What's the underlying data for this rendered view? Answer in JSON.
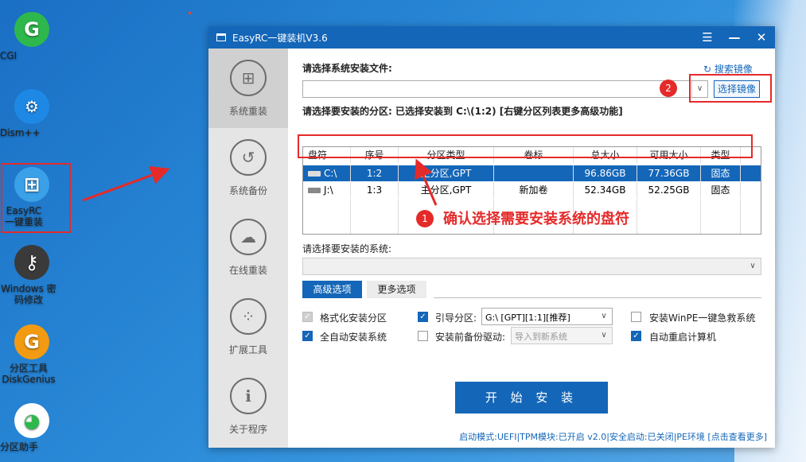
{
  "desktop": {
    "icons": [
      {
        "label": "CGI",
        "glyph": "G",
        "color": "#2eb84c"
      },
      {
        "label": "Dism++",
        "glyph": "⚙",
        "color": "#1e88e5"
      },
      {
        "label": "EasyRC 一键重装",
        "glyph": "⊞",
        "color": "#3aa0e8"
      },
      {
        "label": "Windows 密码修改",
        "glyph": "⚷",
        "color": "#3a3a3a"
      },
      {
        "label": "分区工具 DiskGenius",
        "glyph": "G",
        "color": "#f29b12"
      },
      {
        "label": "分区助手",
        "glyph": "◕",
        "color": "#ffffff"
      }
    ]
  },
  "window": {
    "title": "EasyRC一键装机V3.6",
    "menu_icon": "menu-icon",
    "minimize": "—",
    "close": "✕"
  },
  "sidebar": {
    "items": [
      {
        "label": "系统重装",
        "icon": "windows-icon",
        "glyph": "⊞"
      },
      {
        "label": "系统备份",
        "icon": "backup-icon",
        "glyph": "↺"
      },
      {
        "label": "在线重装",
        "icon": "cloud-icon",
        "glyph": "☁"
      },
      {
        "label": "扩展工具",
        "icon": "tools-icon",
        "glyph": "⁘"
      },
      {
        "label": "关于程序",
        "icon": "info-icon",
        "glyph": "i"
      }
    ]
  },
  "main": {
    "install_file_label": "请选择系统安装文件:",
    "search_image": "搜索镜像",
    "select_image": "选择镜像",
    "partition_label": "请选择要安装的分区: 已选择安装到 C:\\(1:2) [右键分区列表更多高级功能]",
    "table": {
      "headers": [
        "盘符",
        "序号",
        "分区类型",
        "卷标",
        "总大小",
        "可用大小",
        "类型"
      ],
      "rows": [
        [
          "C:\\",
          "1:2",
          "主分区,GPT",
          "",
          "96.86GB",
          "77.36GB",
          "固态"
        ],
        [
          "J:\\",
          "1:3",
          "主分区,GPT",
          "新加卷",
          "52.34GB",
          "52.25GB",
          "固态"
        ]
      ]
    },
    "system_label": "请选择要安装的系统:",
    "tabs": [
      "高级选项",
      "更多选项"
    ],
    "options": {
      "format": "格式化安装分区",
      "auto_install": "全自动安装系统",
      "boot_partition": "引导分区:",
      "boot_value": "G:\\ [GPT][1:1][推荐]",
      "backup_driver": "安装前备份驱动:",
      "backup_value": "导入到新系统",
      "winpe": "安装WinPE一键急救系统",
      "auto_restart": "自动重启计算机"
    },
    "start_button": "开 始 安 装",
    "status": "启动模式:UEFI|TPM模块:已开启 v2.0|安全启动:已关闭|PE环境 [点击查看更多]"
  },
  "annotations": {
    "num1": "1",
    "num2": "2",
    "text1": "确认选择需要安装系统的盘符",
    "accent": "#e52a2a"
  }
}
